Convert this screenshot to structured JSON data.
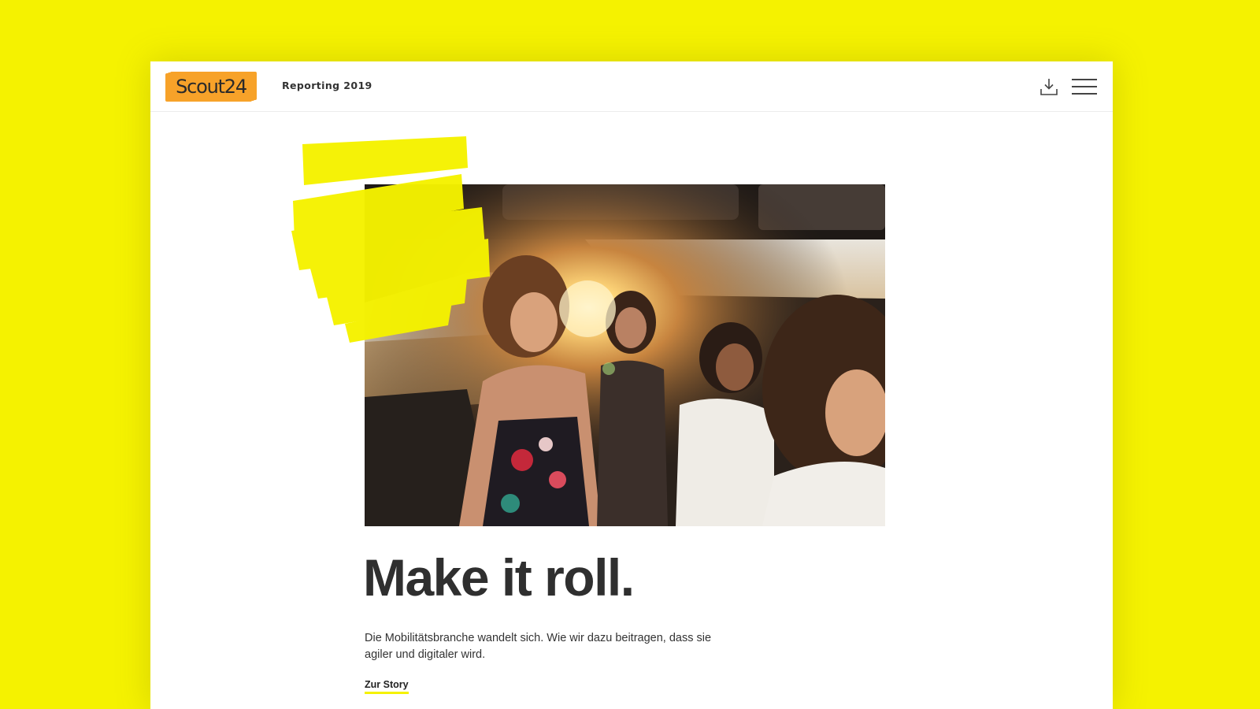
{
  "header": {
    "logo_text": "Scout24",
    "report_title": "Reporting 2019",
    "download_icon": "download-icon",
    "menu_icon": "hamburger-menu-icon"
  },
  "hero": {
    "image_description_icon": "hero-photo"
  },
  "content": {
    "headline": "Make it roll.",
    "lead": "Die Mobilitätsbranche wandelt sich. Wie wir dazu beitragen, dass sie agiler und digitaler wird.",
    "cta_label": "Zur Story"
  },
  "colors": {
    "background": "#f5f200",
    "logo": "#f7a229",
    "accent": "#f5f200",
    "text": "#2f2f2f"
  }
}
